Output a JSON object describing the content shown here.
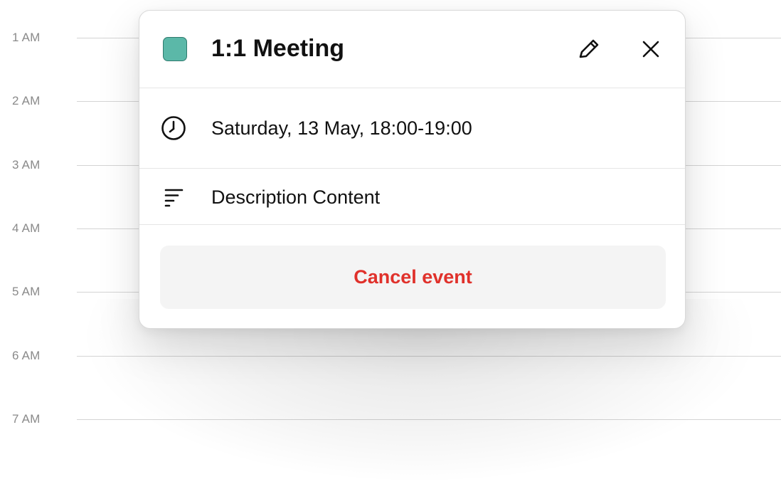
{
  "calendar": {
    "hours": [
      "1 AM",
      "2 AM",
      "3 AM",
      "4 AM",
      "5 AM",
      "6 AM",
      "7 AM"
    ]
  },
  "event": {
    "title": "1:1 Meeting",
    "color": "#5bb8a8",
    "time": "Saturday, 13 May, 18:00-19:00",
    "description": "Description Content",
    "cancel_label": "Cancel event",
    "icons": {
      "edit": "pencil-icon",
      "close": "close-icon",
      "time": "clock-icon",
      "description": "description-lines-icon"
    }
  },
  "colors": {
    "danger": "#e0312b",
    "grid_line": "#d4d4d4",
    "hour_label": "#8a8a8a"
  }
}
